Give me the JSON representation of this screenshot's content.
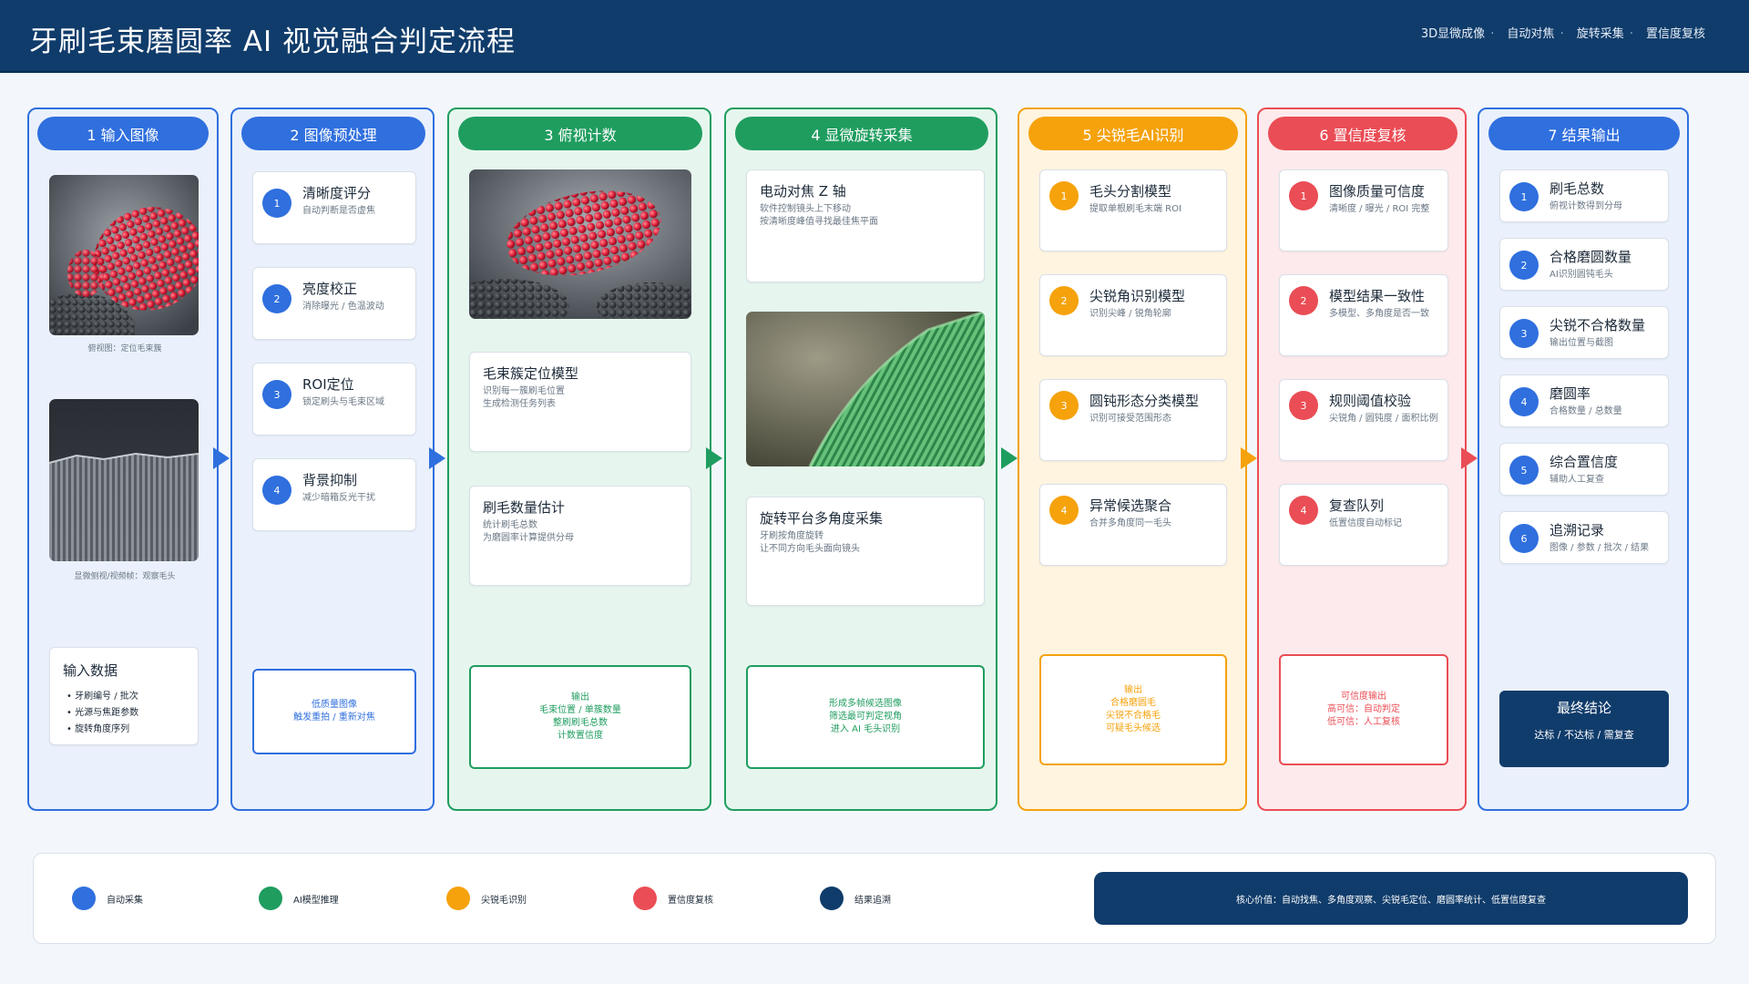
{
  "header": {
    "title": "牙刷毛束磨圆率 AI 视觉融合判定流程",
    "tags": [
      "3D显微成像",
      "自动对焦",
      "旋转采集",
      "置信度复核"
    ]
  },
  "colors": {
    "blue": "#2f6fde",
    "green": "#1f9d5f",
    "orange": "#f5a20c",
    "red": "#ea4d55",
    "navy": "#103c6b"
  },
  "col1": {
    "head": "1  输入图像",
    "caption1": "俯视图：定位毛束簇",
    "caption2": "显微侧视/视频帧：观察毛头",
    "data_title": "输入数据",
    "data_items": [
      "• 牙刷编号 / 批次",
      "• 光源与焦距参数",
      "• 旋转角度序列"
    ]
  },
  "col2": {
    "head": "2  图像预处理",
    "cards": [
      {
        "n": "1",
        "t": "清晰度评分",
        "s": "自动判断是否虚焦"
      },
      {
        "n": "2",
        "t": "亮度校正",
        "s": "消除曝光 / 色温波动"
      },
      {
        "n": "3",
        "t": "ROI定位",
        "s": "锁定刷头与毛束区域"
      },
      {
        "n": "4",
        "t": "背景抑制",
        "s": "减少暗箱反光干扰"
      }
    ],
    "out": [
      "低质量图像",
      "触发重拍 / 重新对焦"
    ]
  },
  "col3": {
    "head": "3  俯视计数",
    "cards": [
      {
        "t": "毛束簇定位模型",
        "s1": "识别每一簇刷毛位置",
        "s2": "生成检测任务列表"
      },
      {
        "t": "刷毛数量估计",
        "s1": "统计刷毛总数",
        "s2": "为磨圆率计算提供分母"
      }
    ],
    "out": [
      "输出",
      "毛束位置 / 单簇数量",
      "整刷刷毛总数",
      "计数置信度"
    ]
  },
  "col4": {
    "head": "4  显微旋转采集",
    "cards": [
      {
        "t": "电动对焦 Z 轴",
        "s1": "软件控制镜头上下移动",
        "s2": "按清晰度峰值寻找最佳焦平面"
      },
      {
        "t": "旋转平台多角度采集",
        "s1": "牙刷按角度旋转",
        "s2": "让不同方向毛头面向镜头"
      }
    ],
    "out": [
      "形成多帧候选图像",
      "筛选最可判定视角",
      "进入 AI 毛头识别"
    ]
  },
  "col5": {
    "head": "5  尖锐毛AI识别",
    "cards": [
      {
        "n": "1",
        "t": "毛头分割模型",
        "s": "提取单根刷毛末端 ROI"
      },
      {
        "n": "2",
        "t": "尖锐角识别模型",
        "s": "识别尖峰 / 锐角轮廓"
      },
      {
        "n": "3",
        "t": "圆钝形态分类模型",
        "s": "识别可接受范围形态"
      },
      {
        "n": "4",
        "t": "异常候选聚合",
        "s": "合并多角度同一毛头"
      }
    ],
    "out": [
      "输出",
      "合格磨圆毛",
      "尖锐不合格毛",
      "可疑毛头候选"
    ]
  },
  "col6": {
    "head": "6  置信度复核",
    "cards": [
      {
        "n": "1",
        "t": "图像质量可信度",
        "s": "清晰度 / 曝光 / ROI 完整"
      },
      {
        "n": "2",
        "t": "模型结果一致性",
        "s": "多模型、多角度是否一致"
      },
      {
        "n": "3",
        "t": "规则阈值校验",
        "s": "尖锐角 / 圆钝度 / 面积比例"
      },
      {
        "n": "4",
        "t": "复查队列",
        "s": "低置信度自动标记"
      }
    ],
    "out": [
      "可信度输出",
      "高可信：自动判定",
      "低可信：人工复核"
    ]
  },
  "col7": {
    "head": "7  结果输出",
    "cards": [
      {
        "n": "1",
        "t": "刷毛总数",
        "s": "俯视计数得到分母"
      },
      {
        "n": "2",
        "t": "合格磨圆数量",
        "s": "AI识别圆钝毛头"
      },
      {
        "n": "3",
        "t": "尖锐不合格数量",
        "s": "输出位置与截图"
      },
      {
        "n": "4",
        "t": "磨圆率",
        "s": "合格数量 / 总数量"
      },
      {
        "n": "5",
        "t": "综合置信度",
        "s": "辅助人工复查"
      },
      {
        "n": "6",
        "t": "追溯记录",
        "s": "图像 / 参数 / 批次 / 结果"
      }
    ],
    "final_title": "最终结论",
    "final_sub": "达标 / 不达标 / 需复查"
  },
  "legend": {
    "items": [
      {
        "label": "自动采集",
        "color": "#2f6fde"
      },
      {
        "label": "AI模型推理",
        "color": "#1f9d5f"
      },
      {
        "label": "尖锐毛识别",
        "color": "#f5a20c"
      },
      {
        "label": "置信度复核",
        "color": "#ea4d55"
      },
      {
        "label": "结果追溯",
        "color": "#103c6b"
      }
    ],
    "core": "核心价值：自动找焦、多角度观察、尖锐毛定位、磨圆率统计、低置信度复查"
  }
}
